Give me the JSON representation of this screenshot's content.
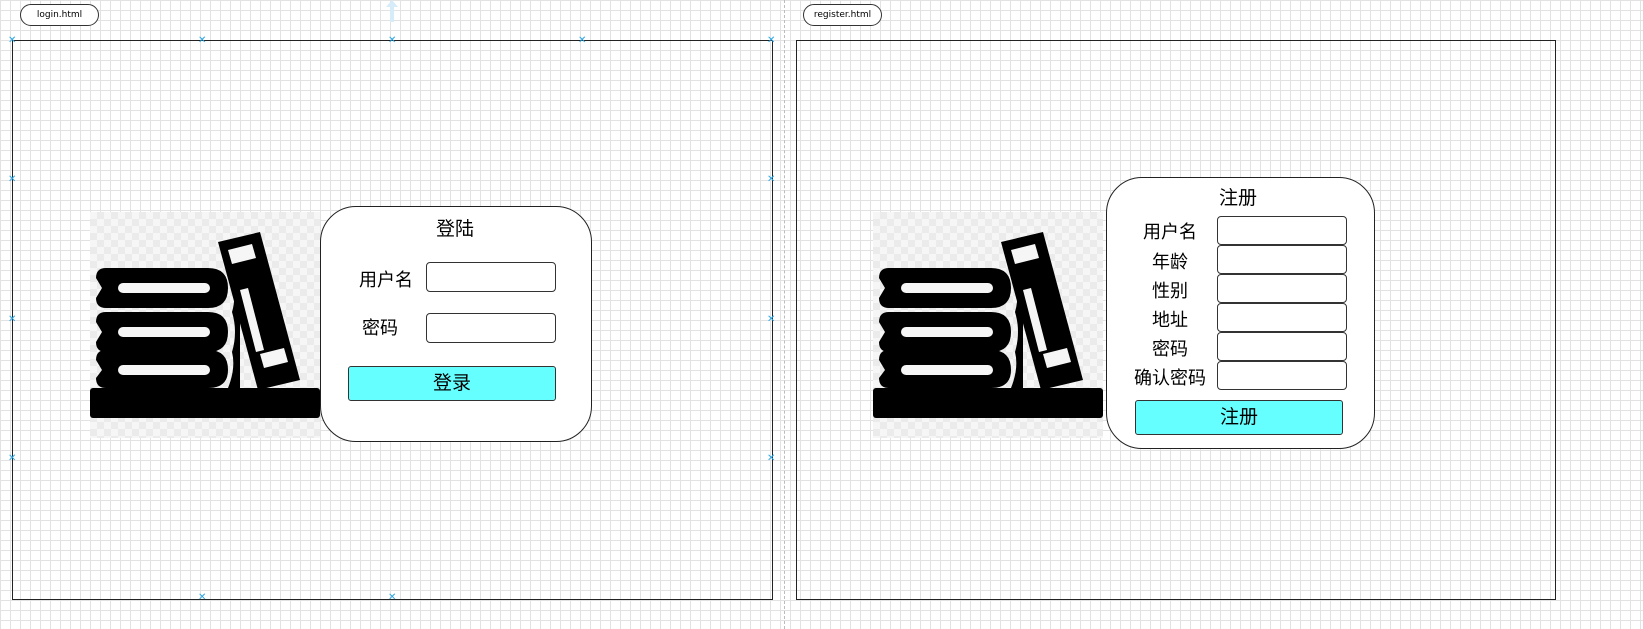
{
  "canvas": {
    "grid_color": "#e2e2e2",
    "handle_color": "#29a7e8"
  },
  "login_page": {
    "tab_label": "login.html",
    "title": "登陆",
    "fields": [
      {
        "label": "用户名",
        "value": ""
      },
      {
        "label": "密码",
        "value": ""
      }
    ],
    "submit_label": "登录",
    "button_color": "#66ffff",
    "image_icon": "books-icon"
  },
  "register_page": {
    "tab_label": "register.html",
    "title": "注册",
    "fields": [
      {
        "label": "用户名",
        "value": ""
      },
      {
        "label": "年龄",
        "value": ""
      },
      {
        "label": "性别",
        "value": ""
      },
      {
        "label": "地址",
        "value": ""
      },
      {
        "label": "密码",
        "value": ""
      },
      {
        "label": "确认密码",
        "value": ""
      }
    ],
    "submit_label": "注册",
    "button_color": "#66ffff",
    "image_icon": "books-icon"
  }
}
